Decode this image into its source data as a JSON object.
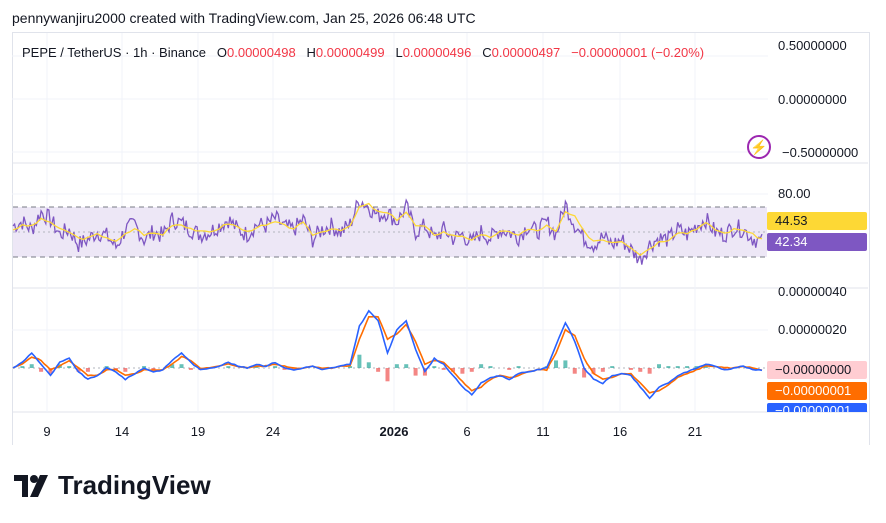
{
  "credit": "pennywanjiru2000 created with TradingView.com, Jan 25, 2026 06:48 UTC",
  "legend": {
    "symbol": "PEPE / TetherUS · 1h · Binance",
    "o_label": "O",
    "o": "0.00000498",
    "h_label": "H",
    "h": "0.00000499",
    "l_label": "L",
    "l": "0.00000496",
    "c_label": "C",
    "c": "0.00000497",
    "change": "−0.00000001 (−0.20%)"
  },
  "price_axis": [
    "0.50000000",
    "0.00000000",
    "−0.50000000"
  ],
  "rsi_axis": [
    "80.00"
  ],
  "rsi_tags": {
    "ma": "44.53",
    "rsi": "42.34"
  },
  "macd_axis": [
    "0.00000040",
    "0.00000020"
  ],
  "macd_tags": {
    "hist": "−0.00000000",
    "signal": "−0.00000001",
    "macd": "−0.00000001"
  },
  "x_axis": [
    "9",
    "14",
    "19",
    "24",
    "2026",
    "6",
    "11",
    "16",
    "21"
  ],
  "logo_text": "TradingView",
  "colors": {
    "rsi": "#7e57c2",
    "rsi_ma": "#fdd835",
    "macd": "#2962ff",
    "signal": "#ff6d00",
    "hist_up": "#26a69a",
    "hist_down": "#ef5350",
    "band": "#ede7f6"
  },
  "chart_data": [
    {
      "type": "line",
      "title": "RSI",
      "ylim": [
        30,
        70
      ],
      "bands": [
        30,
        70
      ],
      "x_range_days": [
        "Dec 7",
        "Jan 25"
      ],
      "values": [
        55,
        58,
        52,
        66,
        60,
        48,
        52,
        40,
        44,
        50,
        47,
        38,
        52,
        56,
        44,
        50,
        47,
        60,
        57,
        52,
        48,
        50,
        55,
        60,
        52,
        48,
        56,
        55,
        61,
        54,
        52,
        60,
        44,
        52,
        55,
        50,
        56,
        76,
        70,
        63,
        66,
        58,
        70,
        50,
        55,
        45,
        52,
        45,
        48,
        41,
        50,
        45,
        52,
        50,
        46,
        55,
        50,
        58,
        48,
        72,
        56,
        45,
        40,
        46,
        40,
        44,
        36,
        28,
        40,
        45,
        44,
        52,
        48,
        55,
        60,
        50,
        48,
        54,
        52,
        45,
        42
      ],
      "ma_values": [
        52,
        55,
        55,
        60,
        58,
        52,
        50,
        45,
        45,
        48,
        46,
        42,
        48,
        53,
        48,
        49,
        48,
        56,
        56,
        53,
        50,
        50,
        53,
        57,
        54,
        50,
        54,
        55,
        58,
        55,
        53,
        57,
        48,
        50,
        53,
        52,
        54,
        70,
        72,
        66,
        65,
        60,
        66,
        55,
        54,
        48,
        50,
        47,
        47,
        44,
        47,
        46,
        50,
        50,
        48,
        52,
        51,
        55,
        50,
        66,
        62,
        50,
        43,
        44,
        42,
        43,
        38,
        32,
        37,
        42,
        44,
        50,
        49,
        53,
        57,
        52,
        49,
        52,
        52,
        48,
        44.5
      ]
    },
    {
      "type": "line",
      "title": "MACD",
      "unit": 1e-08,
      "ylim": [
        -22,
        40
      ],
      "macd": [
        0,
        3,
        8,
        2,
        -4,
        3,
        5,
        -2,
        -6,
        -4,
        0,
        -2,
        -6,
        -3,
        0,
        -2,
        -1,
        4,
        8,
        3,
        -1,
        0,
        1,
        3,
        1,
        0,
        2,
        1,
        3,
        0,
        -1,
        0,
        1,
        -1,
        0,
        1,
        2,
        22,
        30,
        25,
        8,
        20,
        25,
        10,
        -2,
        5,
        2,
        -4,
        -10,
        -14,
        -8,
        -5,
        -4,
        -6,
        -3,
        -2,
        -1,
        0,
        12,
        24,
        14,
        0,
        -6,
        -8,
        -4,
        -3,
        -4,
        -10,
        -16,
        -10,
        -8,
        -4,
        -2,
        0,
        2,
        1,
        -1,
        0,
        1,
        -1,
        -1
      ],
      "signal": [
        0,
        2,
        6,
        4,
        -1,
        1,
        4,
        0,
        -4,
        -4,
        -1,
        -1,
        -4,
        -3,
        -1,
        -1,
        -1,
        2,
        6,
        4,
        0,
        0,
        1,
        2,
        1,
        0,
        1,
        1,
        2,
        1,
        0,
        0,
        1,
        0,
        0,
        1,
        1,
        15,
        27,
        27,
        15,
        18,
        23,
        14,
        2,
        4,
        3,
        -2,
        -7,
        -12,
        -10,
        -6,
        -4,
        -5,
        -4,
        -2,
        -1,
        -1,
        8,
        20,
        17,
        5,
        -3,
        -6,
        -5,
        -3,
        -3,
        -8,
        -13,
        -12,
        -9,
        -5,
        -3,
        -1,
        1,
        1,
        0,
        0,
        1,
        0,
        -1
      ]
    }
  ]
}
